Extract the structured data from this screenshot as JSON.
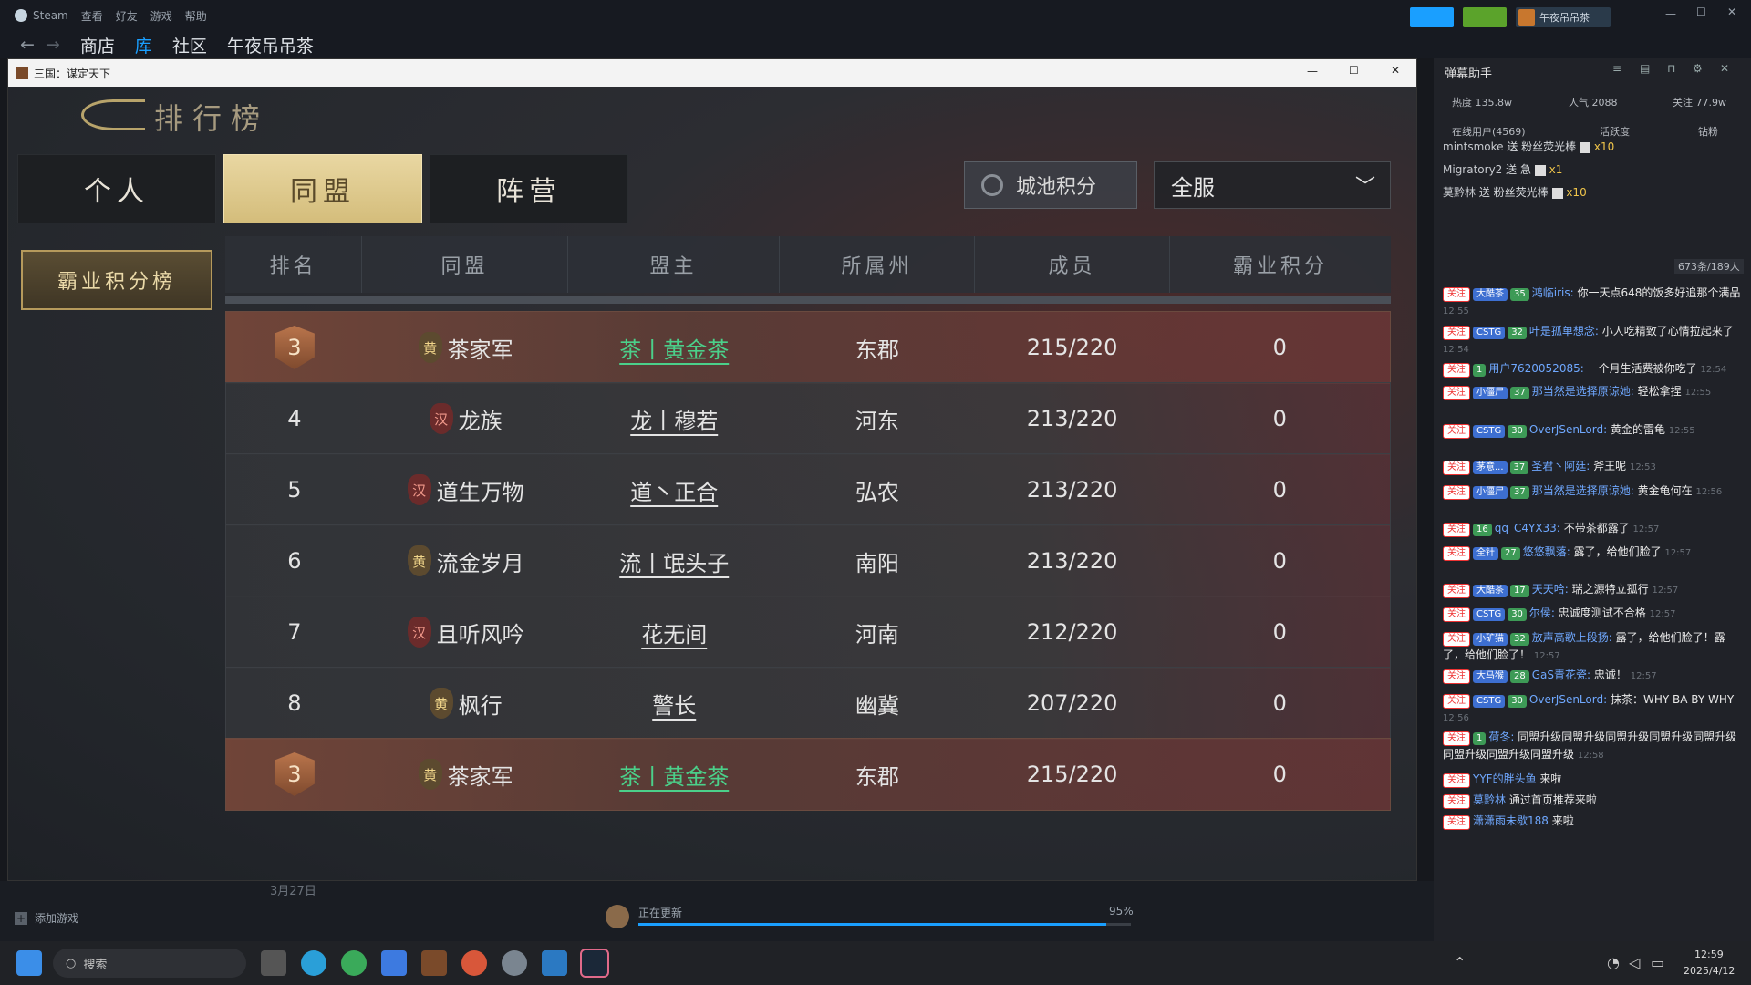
{
  "steam": {
    "app_name": "Steam",
    "menu": [
      "查看",
      "好友",
      "游戏",
      "帮助"
    ],
    "nav": [
      "商店",
      "库",
      "社区",
      "午夜吊吊茶"
    ],
    "user_label": "午夜吊吊茶"
  },
  "game": {
    "window_title": "三国：谋定天下",
    "page_title": "排行榜",
    "tabs": [
      "个人",
      "同盟",
      "阵营"
    ],
    "side_button": "霸业积分榜",
    "search_label": "城池积分",
    "select_value": "全服",
    "columns": [
      "排名",
      "同盟",
      "盟主",
      "所属州",
      "成员",
      "霸业积分"
    ],
    "rows": [
      {
        "rank": "3",
        "tag": "黄",
        "alliance": "茶家军",
        "leader": "茶丨黄金茶",
        "region": "东郡",
        "members": "215/220",
        "score": "0"
      },
      {
        "rank": "4",
        "tag": "汉",
        "alliance": "龙族",
        "leader": "龙丨穆若",
        "region": "河东",
        "members": "213/220",
        "score": "0"
      },
      {
        "rank": "5",
        "tag": "汉",
        "alliance": "道生万物",
        "leader": "道丶正合",
        "region": "弘农",
        "members": "213/220",
        "score": "0"
      },
      {
        "rank": "6",
        "tag": "黄",
        "alliance": "流金岁月",
        "leader": "流丨氓头子",
        "region": "南阳",
        "members": "213/220",
        "score": "0"
      },
      {
        "rank": "7",
        "tag": "汉",
        "alliance": "且听风吟",
        "leader": "花无间",
        "region": "河南",
        "members": "212/220",
        "score": "0"
      },
      {
        "rank": "8",
        "tag": "黄",
        "alliance": "枫行",
        "leader": "警长",
        "region": "幽冀",
        "members": "207/220",
        "score": "0"
      }
    ],
    "own_row": {
      "rank": "3",
      "tag": "黄",
      "alliance": "茶家军",
      "leader": "茶丨黄金茶",
      "region": "东郡",
      "members": "215/220",
      "score": "0"
    }
  },
  "library_bottom": {
    "add_game": "添加游戏",
    "update_label": "正在更新",
    "update_pct": "95%",
    "update_progress": 0.95,
    "date_text": "3月27日"
  },
  "danmu": {
    "title": "弹幕助手",
    "stats": [
      "热度 135.8w",
      "人气 2088",
      "关注 77.9w"
    ],
    "tabs": [
      "在线用户(4569)",
      "活跃度",
      "钻粉"
    ],
    "gifts": [
      {
        "user": "mintsmoke",
        "text": "送 粉丝荧光棒",
        "count": "x10"
      },
      {
        "user": "Migratory2",
        "text": "送 急",
        "count": "x1"
      },
      {
        "user": "莫黔林",
        "text": "送 粉丝荧光棒",
        "count": "x10"
      }
    ],
    "count_badge": "673条/189人",
    "messages": [
      {
        "badge": "大酷茶",
        "lvl": "35",
        "user": "鸿临iris:",
        "text": "你一天点648的饭多好追那个满品",
        "time": "12:55"
      },
      {
        "badge": "CSTG",
        "lvl": "32",
        "user": "叶是孤单想念:",
        "text": "小人吃精致了心情拉起来了",
        "time": "12:54"
      },
      {
        "badge": "",
        "lvl": "1",
        "user": "用户7620052085:",
        "text": "一个月生活费被你吃了",
        "time": "12:54"
      },
      {
        "badge": "小僵尸",
        "lvl": "37",
        "user": "那当然是选择原谅她:",
        "text": "轻松拿捏",
        "time": "12:55"
      },
      {
        "badge": "CSTG",
        "lvl": "30",
        "user": "OverJSenLord:",
        "text": "黄金的雷龟",
        "time": "12:55"
      },
      {
        "badge": "茅意...",
        "lvl": "37",
        "user": "圣君丶阿廷:",
        "text": "斧王呢",
        "time": "12:53"
      },
      {
        "badge": "小僵尸",
        "lvl": "37",
        "user": "那当然是选择原谅她:",
        "text": "黄金龟何在",
        "time": "12:56"
      },
      {
        "badge": "",
        "lvl": "16",
        "user": "qq_C4YX33:",
        "text": "不带茶都露了",
        "time": "12:57"
      },
      {
        "badge": "全针",
        "lvl": "27",
        "user": "悠悠飘落:",
        "text": "露了，给他们脸了",
        "time": "12:57"
      },
      {
        "badge": "大酷茶",
        "lvl": "17",
        "user": "天天哈:",
        "text": "瑞之源特立孤行",
        "time": "12:57"
      },
      {
        "badge": "CSTG",
        "lvl": "30",
        "user": "尔侯:",
        "text": "忠诚度测试不合格",
        "time": "12:57"
      },
      {
        "badge": "小矿猫",
        "lvl": "32",
        "user": "放声高歌上段扬:",
        "text": "露了，给他们脸了！露了，给他们脸了！",
        "time": "12:57"
      },
      {
        "badge": "大马猴",
        "lvl": "28",
        "user": "GaS青花瓷:",
        "text": "忠诚！",
        "time": "12:57"
      },
      {
        "badge": "CSTG",
        "lvl": "30",
        "user": "OverJSenLord:",
        "text": "抹茶：WHY BA BY WHY",
        "time": "12:56"
      },
      {
        "badge": "",
        "lvl": "1",
        "user": "荷冬:",
        "text": "同盟升级同盟升级同盟升级同盟升级同盟升级同盟升级同盟升级同盟升级",
        "time": "12:58"
      },
      {
        "badge": "",
        "lvl": "",
        "user": "YYF的胖头鱼",
        "text": "来啦",
        "time": ""
      },
      {
        "badge": "",
        "lvl": "",
        "user": "莫黔林",
        "text": "通过首页推荐来啦",
        "time": ""
      },
      {
        "badge": "",
        "lvl": "",
        "user": "潇潇雨未歇188",
        "text": "来啦",
        "time": ""
      }
    ],
    "follow_label": "关注"
  },
  "taskbar": {
    "search_placeholder": "搜索",
    "time": "12:59",
    "date": "2025/4/12"
  }
}
